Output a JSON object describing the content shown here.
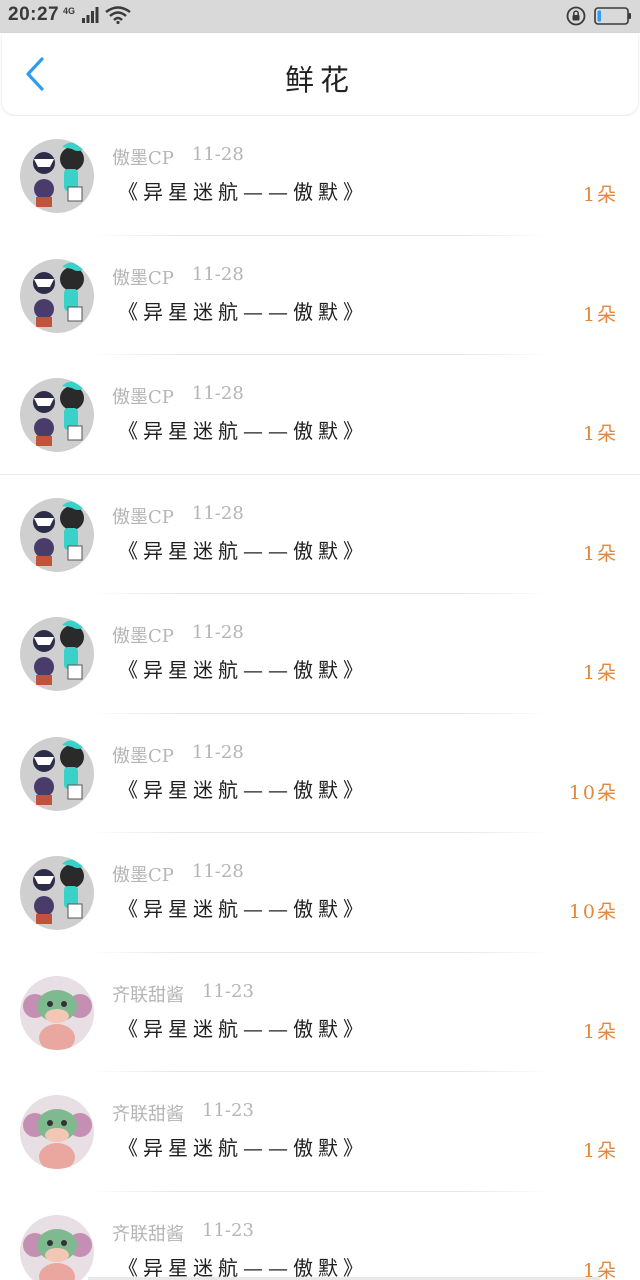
{
  "status_bar": {
    "time": "20:27",
    "network_label": "4G",
    "icons": [
      "signal-icon",
      "wifi-icon",
      "screen-lock-icon",
      "battery-icon"
    ],
    "battery_color": "#2f9cf0"
  },
  "header": {
    "title": "鲜花",
    "back_icon": "chevron-left-icon",
    "accent": "#2f9cf0"
  },
  "list": {
    "items": [
      {
        "user": "傲墨CP",
        "date": "11-28",
        "title": "《异星迷航——傲默》",
        "count": "1朵",
        "avatar": "cat-anime-avatar"
      },
      {
        "user": "傲墨CP",
        "date": "11-28",
        "title": "《异星迷航——傲默》",
        "count": "1朵",
        "avatar": "cat-anime-avatar"
      },
      {
        "user": "傲墨CP",
        "date": "11-28",
        "title": "《异星迷航——傲默》",
        "count": "1朵",
        "avatar": "cat-anime-avatar"
      },
      {
        "user": "傲墨CP",
        "date": "11-28",
        "title": "《异星迷航——傲默》",
        "count": "1朵",
        "avatar": "cat-anime-avatar"
      },
      {
        "user": "傲墨CP",
        "date": "11-28",
        "title": "《异星迷航——傲默》",
        "count": "1朵",
        "avatar": "cat-anime-avatar"
      },
      {
        "user": "傲墨CP",
        "date": "11-28",
        "title": "《异星迷航——傲默》",
        "count": "10朵",
        "avatar": "cat-anime-avatar"
      },
      {
        "user": "傲墨CP",
        "date": "11-28",
        "title": "《异星迷航——傲默》",
        "count": "10朵",
        "avatar": "cat-anime-avatar"
      },
      {
        "user": "齐联甜酱",
        "date": "11-23",
        "title": "《异星迷航——傲默》",
        "count": "1朵",
        "avatar": "frog-anime-avatar"
      },
      {
        "user": "齐联甜酱",
        "date": "11-23",
        "title": "《异星迷航——傲默》",
        "count": "1朵",
        "avatar": "frog-anime-avatar"
      },
      {
        "user": "齐联甜酱",
        "date": "11-23",
        "title": "《异星迷航——傲默》",
        "count": "1朵",
        "avatar": "frog-anime-avatar"
      }
    ]
  },
  "colors": {
    "count_orange": "#e2883e",
    "meta_gray": "#b5b5b5",
    "status_bg": "#d9d9d9"
  }
}
